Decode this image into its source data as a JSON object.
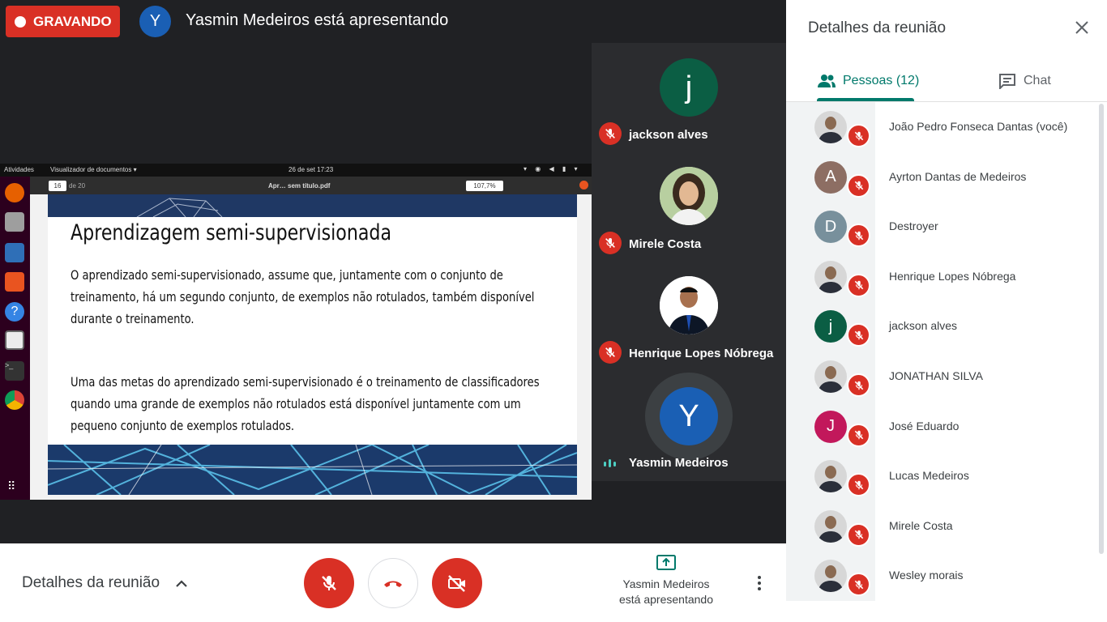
{
  "recording": {
    "label": "GRAVANDO"
  },
  "presenter": {
    "initial": "Y",
    "title": "Yasmin Medeiros está apresentando"
  },
  "tiles": [
    {
      "name": "jackson alves",
      "initial": "j",
      "color": "#0b5e44",
      "muted": true
    },
    {
      "name": "Mirele Costa",
      "photo": true,
      "muted": true
    },
    {
      "name": "Henrique Lopes Nóbrega",
      "photo": true,
      "muted": true
    },
    {
      "name": "Yasmin Medeiros",
      "initial": "Y",
      "color": "#1a5fb4",
      "speaking": true
    }
  ],
  "shared_screen": {
    "topbar": {
      "activities": "Atividades",
      "app": "Visualizador de documentos ▾",
      "clock": "26 de set  17:23"
    },
    "viewer": {
      "page_current": "16",
      "page_total": "de 20",
      "filename": "Apr… sem título.pdf",
      "zoom": "107,7%"
    },
    "slide": {
      "heading": "Aprendizagem semi-supervisionada",
      "paragraph1": "O aprendizado semi-supervisionado, assume que, juntamente com o conjunto de treinamento, há um segundo conjunto, de exemplos não rotulados, também disponível durante o treinamento.",
      "paragraph2": "Uma das metas do aprendizado semi-supervisionado é o treinamento de classificadores quando uma grande de exemplos não rotulados está disponível juntamente com um pequeno conjunto de exemplos rotulados."
    }
  },
  "bottombar": {
    "details_label": "Detalhes da reunião",
    "presenting_line1": "Yasmin Medeiros",
    "presenting_line2": "está apresentando"
  },
  "sidepanel": {
    "title": "Detalhes da reunião",
    "tab_people": "Pessoas (12)",
    "tab_chat": "Chat",
    "people": [
      {
        "name": "João Pedro Fonseca Dantas (você)",
        "photo": true
      },
      {
        "name": "Ayrton Dantas de Medeiros",
        "initial": "A",
        "color": "#8d6e63"
      },
      {
        "name": "Destroyer",
        "initial": "D",
        "color": "#78909c"
      },
      {
        "name": "Henrique Lopes Nóbrega",
        "photo": true
      },
      {
        "name": "jackson alves",
        "initial": "j",
        "color": "#0b5e44"
      },
      {
        "name": "JONATHAN SILVA",
        "photo": true
      },
      {
        "name": "José Eduardo",
        "initial": "J",
        "color": "#c2185b"
      },
      {
        "name": "Lucas Medeiros",
        "photo": true
      },
      {
        "name": "Mirele Costa",
        "photo": true
      },
      {
        "name": "Wesley morais",
        "photo": true
      }
    ]
  },
  "colors": {
    "accent": "#00796b",
    "danger": "#d93025",
    "presenter_blue": "#1a5fb4"
  }
}
